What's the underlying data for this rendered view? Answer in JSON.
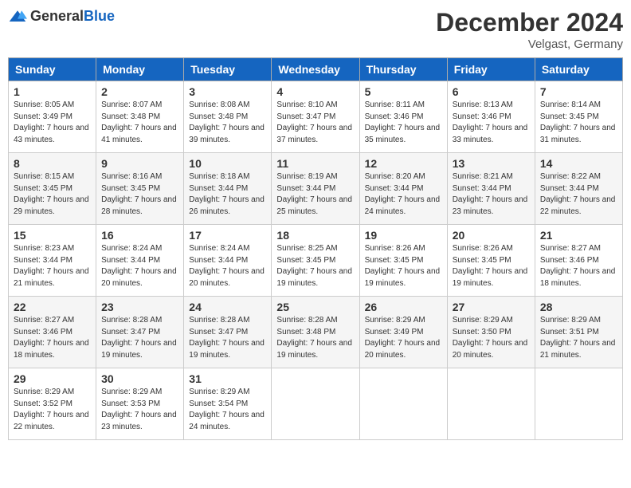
{
  "header": {
    "logo_general": "General",
    "logo_blue": "Blue",
    "month_year": "December 2024",
    "location": "Velgast, Germany"
  },
  "days_of_week": [
    "Sunday",
    "Monday",
    "Tuesday",
    "Wednesday",
    "Thursday",
    "Friday",
    "Saturday"
  ],
  "weeks": [
    [
      {
        "day": "1",
        "sunrise": "8:05 AM",
        "sunset": "3:49 PM",
        "daylight": "7 hours and 43 minutes."
      },
      {
        "day": "2",
        "sunrise": "8:07 AM",
        "sunset": "3:48 PM",
        "daylight": "7 hours and 41 minutes."
      },
      {
        "day": "3",
        "sunrise": "8:08 AM",
        "sunset": "3:48 PM",
        "daylight": "7 hours and 39 minutes."
      },
      {
        "day": "4",
        "sunrise": "8:10 AM",
        "sunset": "3:47 PM",
        "daylight": "7 hours and 37 minutes."
      },
      {
        "day": "5",
        "sunrise": "8:11 AM",
        "sunset": "3:46 PM",
        "daylight": "7 hours and 35 minutes."
      },
      {
        "day": "6",
        "sunrise": "8:13 AM",
        "sunset": "3:46 PM",
        "daylight": "7 hours and 33 minutes."
      },
      {
        "day": "7",
        "sunrise": "8:14 AM",
        "sunset": "3:45 PM",
        "daylight": "7 hours and 31 minutes."
      }
    ],
    [
      {
        "day": "8",
        "sunrise": "8:15 AM",
        "sunset": "3:45 PM",
        "daylight": "7 hours and 29 minutes."
      },
      {
        "day": "9",
        "sunrise": "8:16 AM",
        "sunset": "3:45 PM",
        "daylight": "7 hours and 28 minutes."
      },
      {
        "day": "10",
        "sunrise": "8:18 AM",
        "sunset": "3:44 PM",
        "daylight": "7 hours and 26 minutes."
      },
      {
        "day": "11",
        "sunrise": "8:19 AM",
        "sunset": "3:44 PM",
        "daylight": "7 hours and 25 minutes."
      },
      {
        "day": "12",
        "sunrise": "8:20 AM",
        "sunset": "3:44 PM",
        "daylight": "7 hours and 24 minutes."
      },
      {
        "day": "13",
        "sunrise": "8:21 AM",
        "sunset": "3:44 PM",
        "daylight": "7 hours and 23 minutes."
      },
      {
        "day": "14",
        "sunrise": "8:22 AM",
        "sunset": "3:44 PM",
        "daylight": "7 hours and 22 minutes."
      }
    ],
    [
      {
        "day": "15",
        "sunrise": "8:23 AM",
        "sunset": "3:44 PM",
        "daylight": "7 hours and 21 minutes."
      },
      {
        "day": "16",
        "sunrise": "8:24 AM",
        "sunset": "3:44 PM",
        "daylight": "7 hours and 20 minutes."
      },
      {
        "day": "17",
        "sunrise": "8:24 AM",
        "sunset": "3:44 PM",
        "daylight": "7 hours and 20 minutes."
      },
      {
        "day": "18",
        "sunrise": "8:25 AM",
        "sunset": "3:45 PM",
        "daylight": "7 hours and 19 minutes."
      },
      {
        "day": "19",
        "sunrise": "8:26 AM",
        "sunset": "3:45 PM",
        "daylight": "7 hours and 19 minutes."
      },
      {
        "day": "20",
        "sunrise": "8:26 AM",
        "sunset": "3:45 PM",
        "daylight": "7 hours and 19 minutes."
      },
      {
        "day": "21",
        "sunrise": "8:27 AM",
        "sunset": "3:46 PM",
        "daylight": "7 hours and 18 minutes."
      }
    ],
    [
      {
        "day": "22",
        "sunrise": "8:27 AM",
        "sunset": "3:46 PM",
        "daylight": "7 hours and 18 minutes."
      },
      {
        "day": "23",
        "sunrise": "8:28 AM",
        "sunset": "3:47 PM",
        "daylight": "7 hours and 19 minutes."
      },
      {
        "day": "24",
        "sunrise": "8:28 AM",
        "sunset": "3:47 PM",
        "daylight": "7 hours and 19 minutes."
      },
      {
        "day": "25",
        "sunrise": "8:28 AM",
        "sunset": "3:48 PM",
        "daylight": "7 hours and 19 minutes."
      },
      {
        "day": "26",
        "sunrise": "8:29 AM",
        "sunset": "3:49 PM",
        "daylight": "7 hours and 20 minutes."
      },
      {
        "day": "27",
        "sunrise": "8:29 AM",
        "sunset": "3:50 PM",
        "daylight": "7 hours and 20 minutes."
      },
      {
        "day": "28",
        "sunrise": "8:29 AM",
        "sunset": "3:51 PM",
        "daylight": "7 hours and 21 minutes."
      }
    ],
    [
      {
        "day": "29",
        "sunrise": "8:29 AM",
        "sunset": "3:52 PM",
        "daylight": "7 hours and 22 minutes."
      },
      {
        "day": "30",
        "sunrise": "8:29 AM",
        "sunset": "3:53 PM",
        "daylight": "7 hours and 23 minutes."
      },
      {
        "day": "31",
        "sunrise": "8:29 AM",
        "sunset": "3:54 PM",
        "daylight": "7 hours and 24 minutes."
      },
      null,
      null,
      null,
      null
    ]
  ]
}
